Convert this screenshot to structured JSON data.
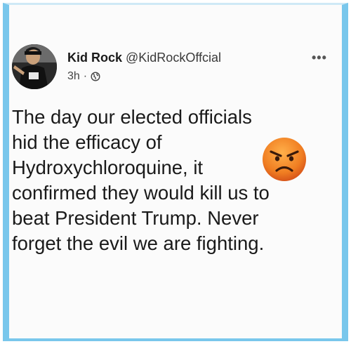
{
  "post": {
    "display_name": "Kid Rock",
    "handle": "@KidRockOffcial",
    "time": "3h",
    "separator": "·",
    "visibility_icon": "globe-icon",
    "more_label": "•••",
    "body_lines": [
      "The day our elected officials",
      "hid the efficacy of",
      "Hydroxychloroquine, it",
      "confirmed they would kill us to",
      "beat President Trump. Never",
      "forget the evil we are fighting."
    ],
    "emoji": "angry-face-icon"
  },
  "colors": {
    "frame": "#79c7ec",
    "emoji_face": "#f08a2a",
    "text": "#1a1a1a"
  }
}
